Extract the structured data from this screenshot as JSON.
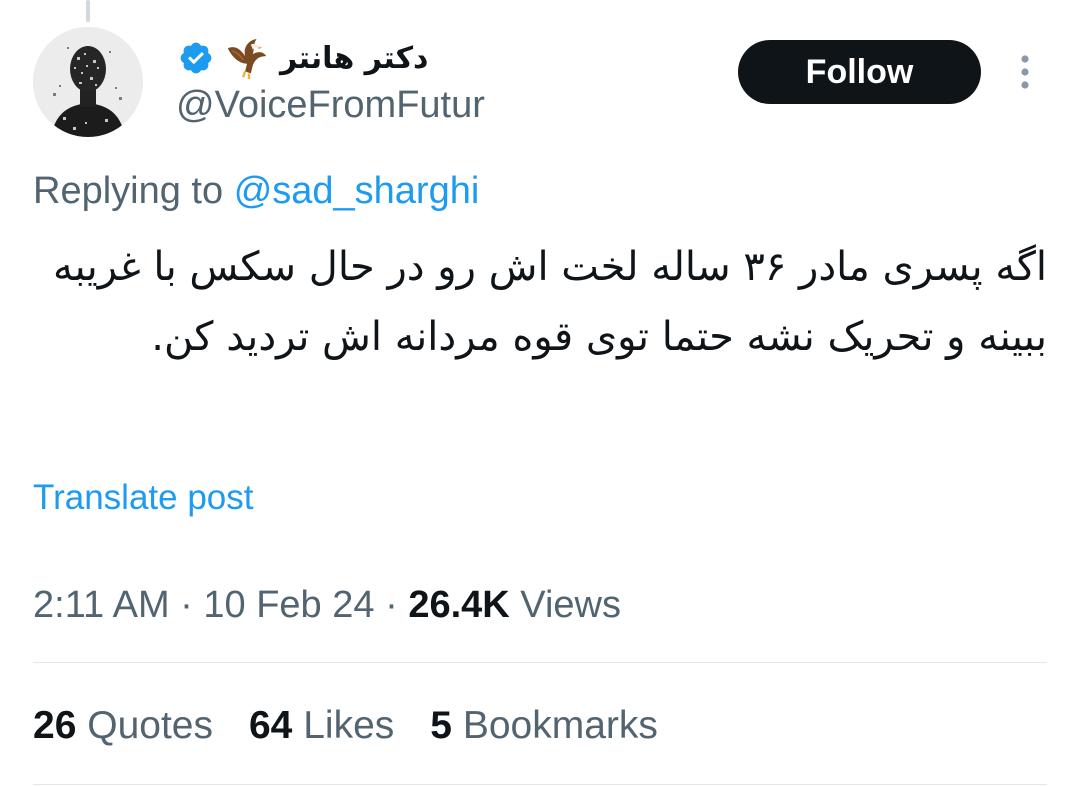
{
  "author": {
    "display_name": "دکتر هانتر",
    "handle": "@VoiceFromFutur",
    "verified": true,
    "avatar_icon": "pixelated-man-avatar",
    "badge_icon": "eagle-emoji"
  },
  "follow_button": {
    "label": "Follow"
  },
  "more_icon": "more-vertical-icon",
  "reply": {
    "prefix": "Replying to",
    "mention": "@sad_sharghi"
  },
  "tweet": {
    "text": "اگه پسری مادر ۳۶ ساله لخت اش رو در حال سکس با غریبه ببینه و تحریک نشه حتما توی قوه مردانه اش تردید کن."
  },
  "translate_link": "Translate post",
  "meta": {
    "time": "2:11 AM",
    "sep1": "·",
    "date": "10 Feb 24",
    "sep2": "·",
    "views_count": "26.4K",
    "views_label": "Views"
  },
  "stats": [
    {
      "count": "26",
      "label": "Quotes"
    },
    {
      "count": "64",
      "label": "Likes"
    },
    {
      "count": "5",
      "label": "Bookmarks"
    }
  ],
  "colors": {
    "accent": "#1d9bf0",
    "text": "#0f1419",
    "secondary": "#536471",
    "button_bg": "#0f1419"
  }
}
